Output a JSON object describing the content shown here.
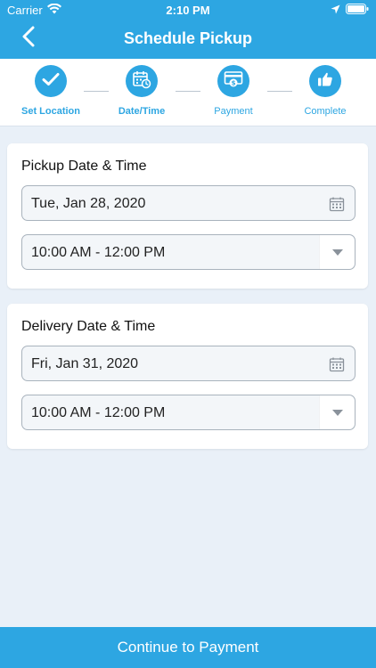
{
  "status_bar": {
    "carrier": "Carrier",
    "time": "2:10 PM"
  },
  "header": {
    "title": "Schedule Pickup",
    "back_icon": "chevron-left-icon",
    "background": "#2da6e2"
  },
  "stepper": {
    "steps": [
      {
        "label": "Set Location",
        "icon": "check-icon",
        "active": true
      },
      {
        "label": "Date/Time",
        "icon": "calendar-clock-icon",
        "active": true
      },
      {
        "label": "Payment",
        "icon": "card-dollar-icon",
        "active": false
      },
      {
        "label": "Complete",
        "icon": "thumbs-up-icon",
        "active": false
      }
    ]
  },
  "pickup": {
    "title": "Pickup Date & Time",
    "date": "Tue, Jan 28, 2020",
    "time_slot": "10:00 AM - 12:00 PM"
  },
  "delivery": {
    "title": "Delivery Date & Time",
    "date": "Fri, Jan 31, 2020",
    "time_slot": "10:00 AM - 12:00 PM"
  },
  "footer": {
    "continue_label": "Continue to Payment"
  },
  "colors": {
    "accent": "#2da6e2",
    "page_background": "#e9f0f8"
  }
}
